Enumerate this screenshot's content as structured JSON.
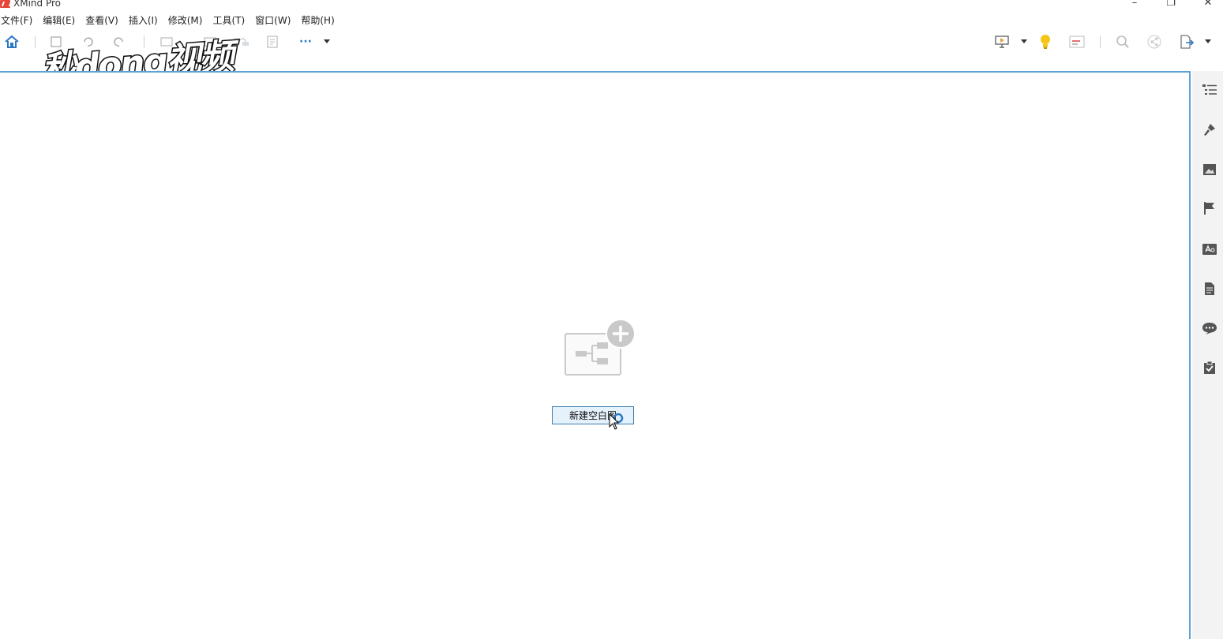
{
  "window": {
    "title": "XMind Pro",
    "controls": {
      "minimize": "–",
      "maximize": "❐",
      "close": "✕"
    }
  },
  "menu": [
    {
      "label": "文件(F)"
    },
    {
      "label": "编辑(E)"
    },
    {
      "label": "查看(V)"
    },
    {
      "label": "插入(I)"
    },
    {
      "label": "修改(M)"
    },
    {
      "label": "工具(T)"
    },
    {
      "label": "窗口(W)"
    },
    {
      "label": "帮助(H)"
    }
  ],
  "toolbar": {
    "left_icons": [
      "home-icon",
      "save-icon",
      "undo-icon",
      "redo-icon",
      "topic-icon",
      "subtopic-icon",
      "relationship-icon",
      "summary-icon",
      "more-icon"
    ],
    "right_icons": [
      "presentation-icon",
      "brainstorm-icon",
      "gantt-icon",
      "search-icon",
      "share-icon",
      "export-icon"
    ],
    "more_label": "···"
  },
  "watermark": {
    "text": "秒dong视频"
  },
  "canvas": {
    "new_blank_map_label": "新建空白图"
  },
  "sidepanel": {
    "icons": [
      "outline-icon",
      "format-icon",
      "image-icon",
      "marker-icon",
      "label-icon",
      "notes-icon",
      "comment-icon",
      "task-icon"
    ]
  },
  "colors": {
    "canvas_border": "#5da2d5",
    "button_bg": "#e5f1fb",
    "button_border": "#3c7fb1",
    "home_icon": "#2b78c5",
    "bulb": "#f5c518"
  }
}
